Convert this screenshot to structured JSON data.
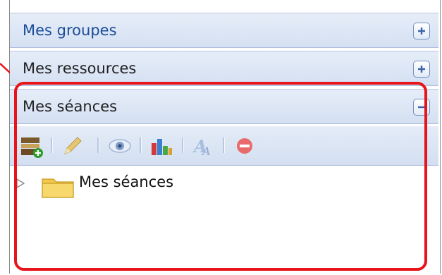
{
  "panel": {
    "sections": [
      {
        "label": "Mes groupes",
        "toggle": "+"
      },
      {
        "label": "Mes ressources",
        "toggle": "+"
      },
      {
        "label": "Mes séances",
        "toggle": "−"
      }
    ]
  },
  "toolbar": {
    "icons": [
      "add-session-icon",
      "edit-pencil-icon",
      "view-eye-icon",
      "chart-icon",
      "rename-text-icon",
      "delete-icon"
    ]
  },
  "tree": {
    "root_label": "Mes séances"
  },
  "colors": {
    "highlight": "#e8141b",
    "header_text": "#1b4c9a",
    "header_bg": "#d4e0f2"
  }
}
